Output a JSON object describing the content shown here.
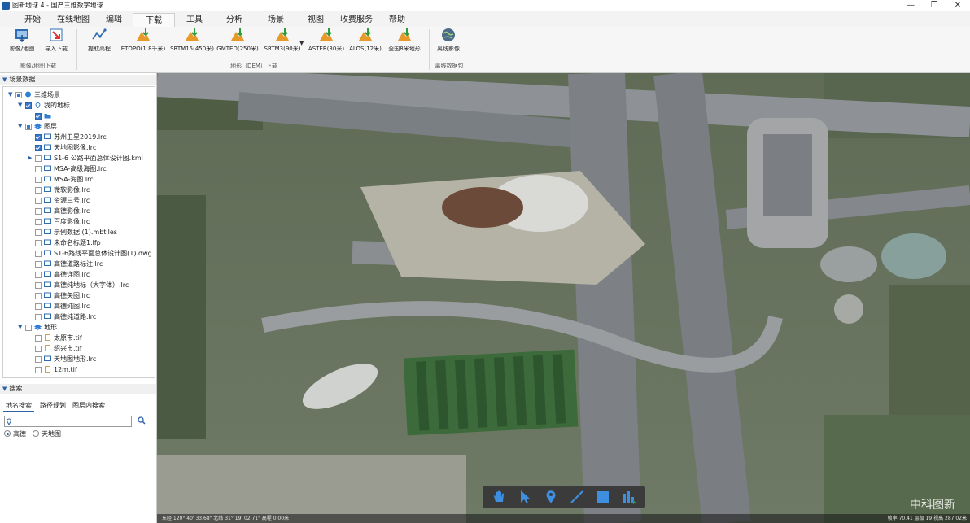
{
  "window": {
    "title": "图新地球 4 - 国产三维数字地球",
    "min_glyph": "—",
    "max_glyph": "❐",
    "close_glyph": "✕"
  },
  "menu_tabs": [
    "开始",
    "在线地图",
    "编辑",
    "下载",
    "工具",
    "分析",
    "场景",
    "视图",
    "收费服务",
    "帮助"
  ],
  "active_menu_tab": "下载",
  "ribbon": {
    "groups": [
      {
        "label": "影像/地图下载",
        "buttons": [
          {
            "label": "影像/地图",
            "icon": "image-map-download-icon"
          },
          {
            "label": "导入下载",
            "icon": "import-download-icon"
          }
        ]
      },
      {
        "label": "地形（DEM）下载",
        "buttons": [
          {
            "label": "提取高程",
            "icon": "elevation-extract-icon"
          },
          {
            "label": "ETOPO(1.8千米)",
            "icon": "terrain-download-icon"
          },
          {
            "label": "SRTM15(450米)",
            "icon": "terrain-download-icon"
          },
          {
            "label": "GMTED(250米)",
            "icon": "terrain-download-icon"
          },
          {
            "label": "SRTM3(90米)",
            "icon": "terrain-download-icon"
          },
          {
            "label": "ASTER(30米)",
            "icon": "terrain-download-icon"
          },
          {
            "label": "ALOS(12米)",
            "icon": "terrain-download-icon"
          },
          {
            "label": "全国8米地形",
            "icon": "terrain-download-icon"
          }
        ]
      },
      {
        "label": "离线数据包",
        "buttons": [
          {
            "label": "离线影像",
            "icon": "globe-icon"
          }
        ]
      }
    ]
  },
  "scene_panel": {
    "title": "场景数据",
    "items": [
      {
        "label": "三维场景",
        "expanded": true,
        "check": "partial",
        "icon": "globe"
      },
      {
        "label": "我的地标",
        "expanded": true,
        "check": "checked",
        "icon": "pin"
      },
      {
        "label": "",
        "expanded": null,
        "check": "checked",
        "icon": "folder"
      },
      {
        "label": "图层",
        "expanded": true,
        "check": "partial",
        "icon": "layers"
      },
      {
        "label": "苏州卫星2019.lrc",
        "expanded": null,
        "check": "checked",
        "icon": "layer"
      },
      {
        "label": "天地图影像.lrc",
        "expanded": null,
        "check": "checked",
        "icon": "layer"
      },
      {
        "label": "S1-6 公路平面总体设计图.kml",
        "expanded": false,
        "check": "unchecked",
        "icon": "layer"
      },
      {
        "label": "MSA-高级海图.lrc",
        "expanded": null,
        "check": "unchecked",
        "icon": "layer"
      },
      {
        "label": "MSA-海图.lrc",
        "expanded": null,
        "check": "unchecked",
        "icon": "layer"
      },
      {
        "label": "微软影像.lrc",
        "expanded": null,
        "check": "unchecked",
        "icon": "layer"
      },
      {
        "label": "资源三号.lrc",
        "expanded": null,
        "check": "unchecked",
        "icon": "layer"
      },
      {
        "label": "高德影像.lrc",
        "expanded": null,
        "check": "unchecked",
        "icon": "layer"
      },
      {
        "label": "百度影像.lrc",
        "expanded": null,
        "check": "unchecked",
        "icon": "layer"
      },
      {
        "label": "示例数据 (1).mbtiles",
        "expanded": null,
        "check": "unchecked",
        "icon": "layer"
      },
      {
        "label": "未命名标题1.lfp",
        "expanded": null,
        "check": "unchecked",
        "icon": "layer"
      },
      {
        "label": "S1-6路线平面总体设计图(1).dwg",
        "expanded": null,
        "check": "unchecked",
        "icon": "layer"
      },
      {
        "label": "高德道路标注.lrc",
        "expanded": null,
        "check": "unchecked",
        "icon": "layer"
      },
      {
        "label": "高德详图.lrc",
        "expanded": null,
        "check": "unchecked",
        "icon": "layer"
      },
      {
        "label": "高德纯地标（大字体）.lrc",
        "expanded": null,
        "check": "unchecked",
        "icon": "layer"
      },
      {
        "label": "高德矢图.lrc",
        "expanded": null,
        "check": "unchecked",
        "icon": "layer"
      },
      {
        "label": "高德纯图.lrc",
        "expanded": null,
        "check": "unchecked",
        "icon": "layer"
      },
      {
        "label": "高德纯道路.lrc",
        "expanded": null,
        "check": "unchecked",
        "icon": "layer"
      },
      {
        "label": "地形",
        "expanded": true,
        "check": "unchecked",
        "icon": "terrain"
      },
      {
        "label": "太原市.tif",
        "expanded": null,
        "check": "unchecked",
        "icon": "file"
      },
      {
        "label": "绍兴市.tif",
        "expanded": null,
        "check": "unchecked",
        "icon": "file"
      },
      {
        "label": "天地图地形.lrc",
        "expanded": null,
        "check": "unchecked",
        "icon": "layer"
      },
      {
        "label": "12m.tif",
        "expanded": null,
        "check": "unchecked",
        "icon": "file"
      }
    ]
  },
  "search_panel": {
    "title": "搜索",
    "tabs": [
      "地名搜索",
      "路径规划",
      "图层内搜索"
    ],
    "active_tab": "地名搜索",
    "input_value": "",
    "search_icon": "search-icon",
    "sources": [
      "高德",
      "天地图"
    ],
    "selected_source": "高德"
  },
  "map": {
    "tools": [
      "pan-hand-icon",
      "select-arrow-icon",
      "placemark-pin-icon",
      "draw-line-icon",
      "draw-polygon-icon",
      "measure-icon"
    ],
    "status_left": "东经 120° 40' 33.68\"  北纬 31° 19' 02.71\"   高程 0.00米",
    "status_right": "帧率 70.41  层级 19  视高 287.02米",
    "watermark": "中科图新"
  }
}
